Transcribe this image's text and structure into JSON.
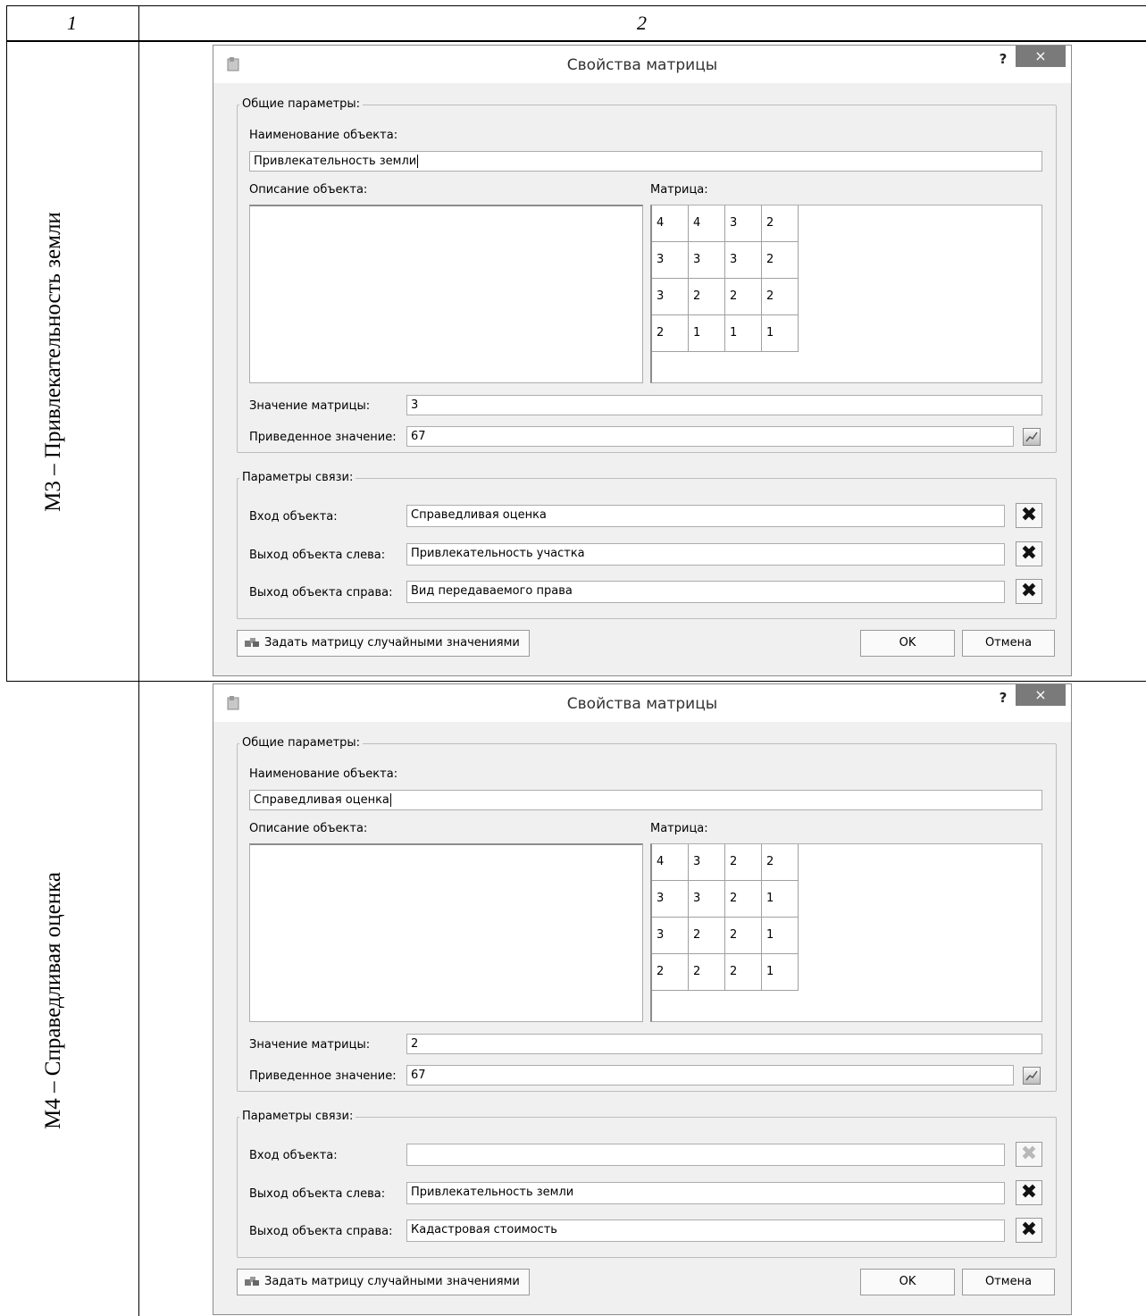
{
  "table": {
    "col1_header": "1",
    "col2_header": "2",
    "rows": [
      {
        "label": "М3 – Привлекательность земли"
      },
      {
        "label": "М4 – Справедливая оценка"
      }
    ]
  },
  "dialogs": [
    {
      "title": "Свойства матрицы",
      "help": "?",
      "close": "×",
      "general_legend": "Общие параметры:",
      "name_label": "Наименование объекта:",
      "name_value": "Привлекательность земли",
      "desc_label": "Описание объекта:",
      "matrix_label": "Матрица:",
      "matrix": [
        [
          "4",
          "4",
          "3",
          "2"
        ],
        [
          "3",
          "3",
          "3",
          "2"
        ],
        [
          "3",
          "2",
          "2",
          "2"
        ],
        [
          "2",
          "1",
          "1",
          "1"
        ]
      ],
      "value_label": "Значение матрицы:",
      "value": "3",
      "reduced_label": "Приведенное значение:",
      "reduced_value": "67",
      "link_legend": "Параметры связи:",
      "input_label": "Вход объекта:",
      "input_value": "Справедливая оценка",
      "input_clear_enabled": true,
      "left_label": "Выход объекта слева:",
      "left_value": "Привлекательность участка",
      "right_label": "Выход объекта справа:",
      "right_value": "Вид передаваемого права",
      "random_button": "Задать матрицу случайными значениями",
      "ok": "OK",
      "cancel": "Отмена"
    },
    {
      "title": "Свойства матрицы",
      "help": "?",
      "close": "×",
      "general_legend": "Общие параметры:",
      "name_label": "Наименование объекта:",
      "name_value": "Справедливая оценка",
      "desc_label": "Описание объекта:",
      "matrix_label": "Матрица:",
      "matrix": [
        [
          "4",
          "3",
          "2",
          "2"
        ],
        [
          "3",
          "3",
          "2",
          "1"
        ],
        [
          "3",
          "2",
          "2",
          "1"
        ],
        [
          "2",
          "2",
          "2",
          "1"
        ]
      ],
      "value_label": "Значение матрицы:",
      "value": "2",
      "reduced_label": "Приведенное значение:",
      "reduced_value": "67",
      "link_legend": "Параметры связи:",
      "input_label": "Вход объекта:",
      "input_value": "",
      "input_clear_enabled": false,
      "left_label": "Выход объекта слева:",
      "left_value": "Привлекательность земли",
      "right_label": "Выход объекта справа:",
      "right_value": "Кадастровая стоимость",
      "random_button": "Задать матрицу случайными значениями",
      "ok": "OK",
      "cancel": "Отмена"
    }
  ],
  "icons": {
    "clear": "clear-x-icon",
    "chart": "chart-icon",
    "random": "random-fill-icon",
    "app": "app-icon"
  }
}
